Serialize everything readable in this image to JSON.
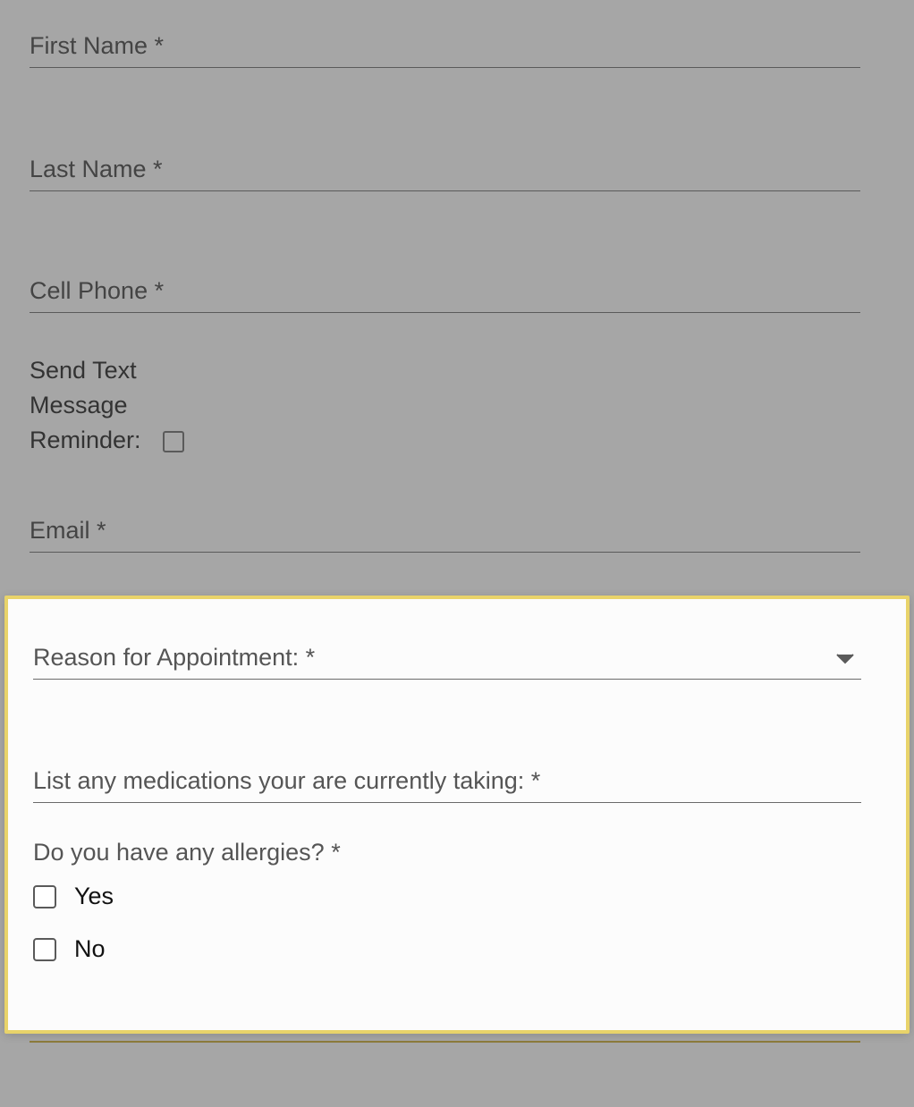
{
  "form": {
    "first_name": {
      "placeholder": "First Name *",
      "value": ""
    },
    "last_name": {
      "placeholder": "Last Name *",
      "value": ""
    },
    "cell_phone": {
      "placeholder": "Cell Phone *",
      "value": ""
    },
    "text_reminder": {
      "label_line1": "Send Text",
      "label_line2": "Message",
      "label_line3": "Reminder:",
      "checked": false
    },
    "email": {
      "placeholder": "Email *",
      "value": ""
    }
  },
  "panel": {
    "reason": {
      "label": "Reason for Appointment: *",
      "value": ""
    },
    "medications": {
      "placeholder": "List any medications your are currently taking: *",
      "value": ""
    },
    "allergies": {
      "question": "Do you have any allergies? *",
      "options": [
        {
          "label": "Yes",
          "checked": false
        },
        {
          "label": "No",
          "checked": false
        }
      ]
    }
  }
}
